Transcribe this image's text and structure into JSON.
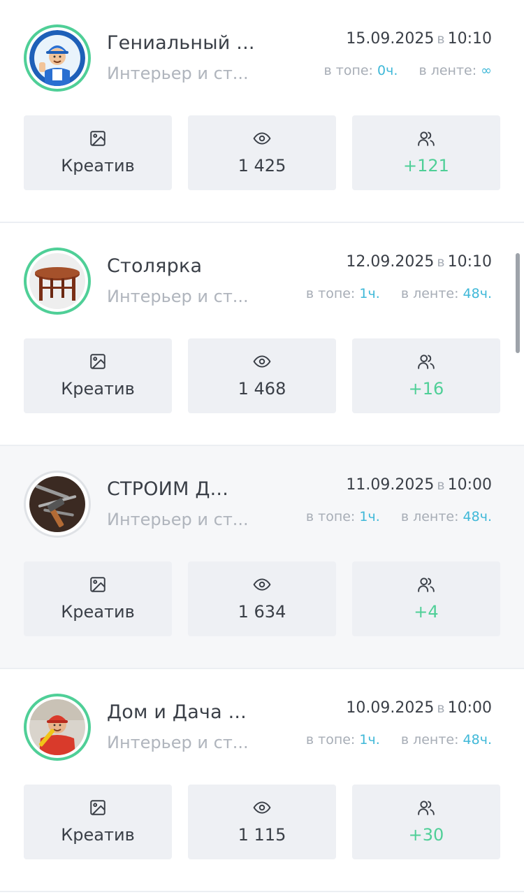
{
  "colors": {
    "accent_green": "#4fcf97",
    "accent_blue": "#3fb8d8",
    "tile_bg": "#eef0f4",
    "text_muted": "#b0b5bd"
  },
  "labels": {
    "date_separator": "в",
    "top_label": "в топе:",
    "feed_label": "в ленте:",
    "creative_label": "Креатив"
  },
  "icons": {
    "creative": "image-icon",
    "views": "eye-icon",
    "subscribers": "users-icon"
  },
  "posts": [
    {
      "name": "Гениальный ...",
      "category": "Интерьер и ст...",
      "date": "15.09.2025",
      "time": "10:10",
      "top_value": "0ч.",
      "feed_value": "∞",
      "views": "1 425",
      "subscribers": "+121",
      "avatar": "handyman-avatar"
    },
    {
      "name": "Столярка",
      "category": "Интерьер и ст...",
      "date": "12.09.2025",
      "time": "10:10",
      "top_value": "1ч.",
      "feed_value": "48ч.",
      "views": "1 468",
      "subscribers": "+16",
      "avatar": "wooden-table-avatar"
    },
    {
      "name": "СТРОИМ Д...",
      "category": "Интерьер и ст...",
      "date": "11.09.2025",
      "time": "10:00",
      "top_value": "1ч.",
      "feed_value": "48ч.",
      "views": "1 634",
      "subscribers": "+4",
      "avatar": "tools-avatar"
    },
    {
      "name": "Дом и Дача ...",
      "category": "Интерьер и ст...",
      "date": "10.09.2025",
      "time": "10:00",
      "top_value": "1ч.",
      "feed_value": "48ч.",
      "views": "1 115",
      "subscribers": "+30",
      "avatar": "builder-avatar"
    }
  ]
}
